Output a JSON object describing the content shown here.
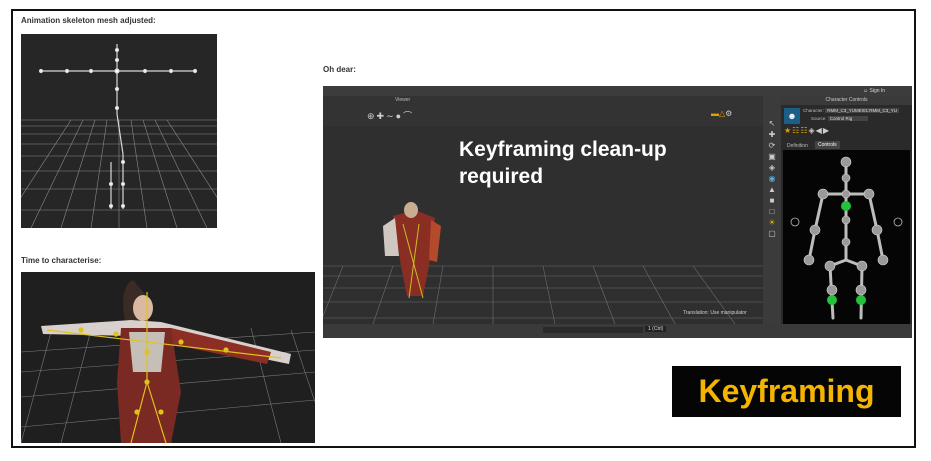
{
  "captions": {
    "mesh": "Animation skeleton mesh adjusted:",
    "characterise": "Time to characterise:",
    "oh_dear": "Oh dear:"
  },
  "viewer": {
    "title": "Viewer",
    "overlay_line1": "Keyframing clean-up",
    "overlay_line2": "required",
    "status": "Translation: Use manipulator",
    "frame_field": "1 (Ctrl)"
  },
  "character_controls": {
    "title": "Character Controls",
    "signin": "Sign In",
    "character_label": "Character:",
    "character_value": "RMM_C3_YUMEI01:RMM_C3_YU",
    "source_label": "Source:",
    "source_value": "Control Rig",
    "tab_definition": "Definition",
    "tab_controls": "Controls"
  },
  "banner": {
    "label": "Keyframing"
  },
  "colors": {
    "banner_bg": "#050505",
    "banner_text": "#f5b400",
    "ik_effector": "#22c33a",
    "skeleton_bone": "#c9c9c9"
  }
}
